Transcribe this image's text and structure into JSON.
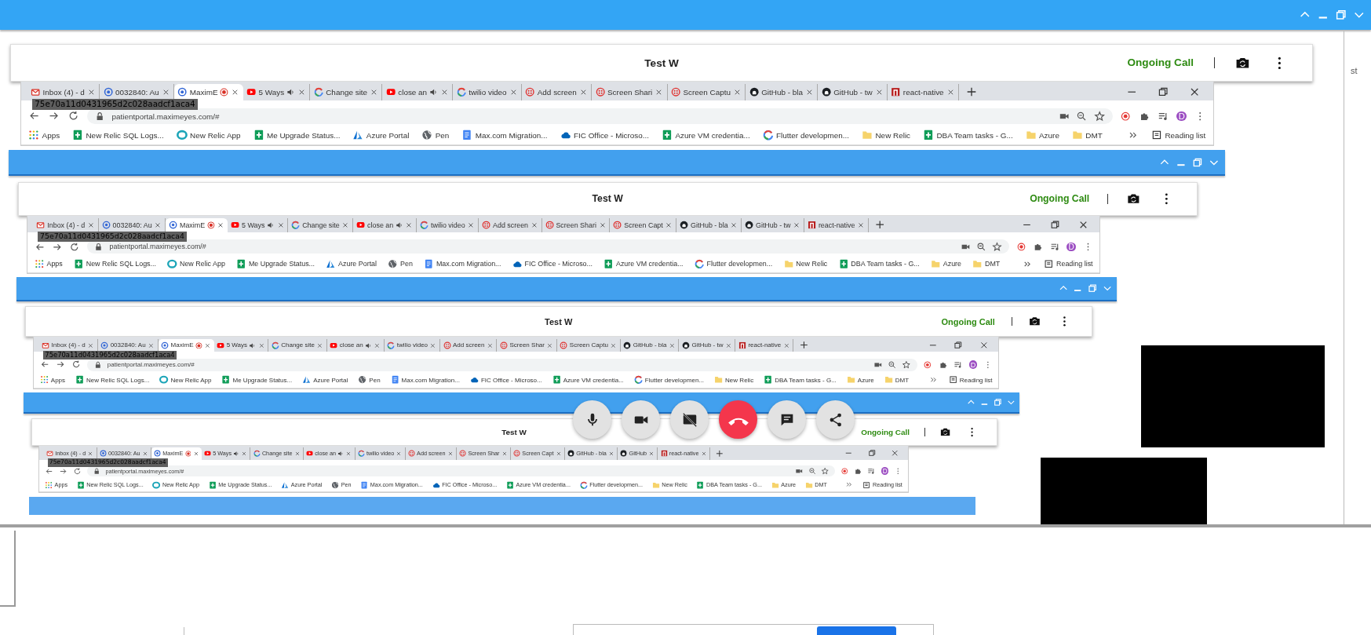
{
  "levels": [
    {
      "title": "Test W",
      "status": "Ongoing Call",
      "tooltip": "75e70a11d0431965d2c028aadcf1aca4",
      "url": "patientportal.maximeyes.com/#",
      "avatar": "D",
      "reading_list": "Reading list",
      "tabs": [
        {
          "label": "Inbox (4) - d",
          "kind": "mail",
          "selected": false,
          "audio": false,
          "recording": false
        },
        {
          "label": "0032840: Au",
          "kind": "swirl",
          "selected": false,
          "audio": false,
          "recording": false
        },
        {
          "label": "MaximE",
          "kind": "swirl",
          "selected": true,
          "audio": false,
          "recording": true
        },
        {
          "label": "5 Ways",
          "kind": "video",
          "selected": false,
          "audio": true,
          "recording": false
        },
        {
          "label": "Change site",
          "kind": "search",
          "selected": false,
          "audio": false,
          "recording": false
        },
        {
          "label": "close an",
          "kind": "video",
          "selected": false,
          "audio": true,
          "recording": false
        },
        {
          "label": "twilio video",
          "kind": "search",
          "selected": false,
          "audio": false,
          "recording": false
        },
        {
          "label": "Add screen",
          "kind": "dots",
          "selected": false,
          "audio": false,
          "recording": false
        },
        {
          "label": "Screen Shari",
          "kind": "dots",
          "selected": false,
          "audio": false,
          "recording": false
        },
        {
          "label": "Screen Captu",
          "kind": "dots",
          "selected": false,
          "audio": false,
          "recording": false
        },
        {
          "label": "GitHub - bla",
          "kind": "octo",
          "selected": false,
          "audio": false,
          "recording": false
        },
        {
          "label": "GitHub - tw",
          "kind": "octo",
          "selected": false,
          "audio": false,
          "recording": false
        },
        {
          "label": "react-native",
          "kind": "square",
          "selected": false,
          "audio": false,
          "recording": false
        }
      ],
      "bookmarks": [
        {
          "label": "Apps",
          "kind": "apps"
        },
        {
          "label": "New Relic SQL Logs...",
          "kind": "sheet"
        },
        {
          "label": "New Relic App",
          "kind": "relic"
        },
        {
          "label": "Me Upgrade Status...",
          "kind": "sheet"
        },
        {
          "label": "Azure Portal",
          "kind": "azure"
        },
        {
          "label": "Pen",
          "kind": "globe"
        },
        {
          "label": "Max.com Migration...",
          "kind": "doc"
        },
        {
          "label": "FIC Office - Microso...",
          "kind": "cloud"
        },
        {
          "label": "Azure VM credentia...",
          "kind": "sheet"
        },
        {
          "label": "Flutter developmen...",
          "kind": "search"
        },
        {
          "label": "New Relic",
          "kind": "folder"
        },
        {
          "label": "DBA Team tasks - G...",
          "kind": "sheet"
        },
        {
          "label": "Azure",
          "kind": "folder"
        },
        {
          "label": "DMT",
          "kind": "folder"
        }
      ]
    },
    {
      "title": "Test W",
      "status": "Ongoing Call",
      "tooltip": "75e70a11d0431965d2c028aadcf1aca4",
      "url": "patientportal.maximeyes.com/#",
      "avatar": "D",
      "reading_list": "Reading list",
      "tabs": [
        {
          "label": "Inbox (4) - d",
          "kind": "mail",
          "selected": false,
          "audio": false,
          "recording": false
        },
        {
          "label": "0032840: Au",
          "kind": "swirl",
          "selected": false,
          "audio": false,
          "recording": false
        },
        {
          "label": "MaximE",
          "kind": "swirl",
          "selected": true,
          "audio": false,
          "recording": true
        },
        {
          "label": "5 Ways",
          "kind": "video",
          "selected": false,
          "audio": true,
          "recording": false
        },
        {
          "label": "Change site",
          "kind": "search",
          "selected": false,
          "audio": false,
          "recording": false
        },
        {
          "label": "close an",
          "kind": "video",
          "selected": false,
          "audio": true,
          "recording": false
        },
        {
          "label": "twilio video",
          "kind": "search",
          "selected": false,
          "audio": false,
          "recording": false
        },
        {
          "label": "Add screen",
          "kind": "dots",
          "selected": false,
          "audio": false,
          "recording": false
        },
        {
          "label": "Screen Shari",
          "kind": "dots",
          "selected": false,
          "audio": false,
          "recording": false
        },
        {
          "label": "Screen Capt",
          "kind": "dots",
          "selected": false,
          "audio": false,
          "recording": false
        },
        {
          "label": "GitHub - bla",
          "kind": "octo",
          "selected": false,
          "audio": false,
          "recording": false
        },
        {
          "label": "GitHub - tw",
          "kind": "octo",
          "selected": false,
          "audio": false,
          "recording": false
        },
        {
          "label": "react-native",
          "kind": "square",
          "selected": false,
          "audio": false,
          "recording": false
        }
      ],
      "bookmarks": [
        {
          "label": "Apps",
          "kind": "apps"
        },
        {
          "label": "New Relic SQL Logs...",
          "kind": "sheet"
        },
        {
          "label": "New Relic App",
          "kind": "relic"
        },
        {
          "label": "Me Upgrade Status...",
          "kind": "sheet"
        },
        {
          "label": "Azure Portal",
          "kind": "azure"
        },
        {
          "label": "Pen",
          "kind": "globe"
        },
        {
          "label": "Max.com Migration...",
          "kind": "doc"
        },
        {
          "label": "FIC Office - Microso...",
          "kind": "cloud"
        },
        {
          "label": "Azure VM credentia...",
          "kind": "sheet"
        },
        {
          "label": "Flutter developmen...",
          "kind": "search"
        },
        {
          "label": "New Relic",
          "kind": "folder"
        },
        {
          "label": "DBA Team tasks - G...",
          "kind": "sheet"
        },
        {
          "label": "Azure",
          "kind": "folder"
        },
        {
          "label": "DMT",
          "kind": "folder"
        }
      ]
    },
    {
      "title": "Test W",
      "status": "Ongoing Call",
      "tooltip": "75e70a11d0431965d2c028aadcf1aca4",
      "url": "patientportal.maximeyes.com/#",
      "avatar": "D",
      "reading_list": "Reading list",
      "tabs": [
        {
          "label": "Inbox (4) - d",
          "kind": "mail",
          "selected": false,
          "audio": false,
          "recording": false
        },
        {
          "label": "0032840: Au",
          "kind": "swirl",
          "selected": false,
          "audio": false,
          "recording": false
        },
        {
          "label": "MaximE",
          "kind": "swirl",
          "selected": true,
          "audio": false,
          "recording": true
        },
        {
          "label": "5 Ways",
          "kind": "video",
          "selected": false,
          "audio": true,
          "recording": false
        },
        {
          "label": "Change site",
          "kind": "search",
          "selected": false,
          "audio": false,
          "recording": false
        },
        {
          "label": "close an",
          "kind": "video",
          "selected": false,
          "audio": true,
          "recording": false
        },
        {
          "label": "twilio video",
          "kind": "search",
          "selected": false,
          "audio": false,
          "recording": false
        },
        {
          "label": "Add screen",
          "kind": "dots",
          "selected": false,
          "audio": false,
          "recording": false
        },
        {
          "label": "Screen Shar",
          "kind": "dots",
          "selected": false,
          "audio": false,
          "recording": false
        },
        {
          "label": "Screen Captu",
          "kind": "dots",
          "selected": false,
          "audio": false,
          "recording": false
        },
        {
          "label": "GitHub - bla",
          "kind": "octo",
          "selected": false,
          "audio": false,
          "recording": false
        },
        {
          "label": "GitHub - tw",
          "kind": "octo",
          "selected": false,
          "audio": false,
          "recording": false
        },
        {
          "label": "react-native",
          "kind": "square",
          "selected": false,
          "audio": false,
          "recording": false
        }
      ],
      "bookmarks": [
        {
          "label": "Apps",
          "kind": "apps"
        },
        {
          "label": "New Relic SQL Logs...",
          "kind": "sheet"
        },
        {
          "label": "New Relic App",
          "kind": "relic"
        },
        {
          "label": "Me Upgrade Status...",
          "kind": "sheet"
        },
        {
          "label": "Azure Portal",
          "kind": "azure"
        },
        {
          "label": "Pen",
          "kind": "globe"
        },
        {
          "label": "Max.com Migration...",
          "kind": "doc"
        },
        {
          "label": "FIC Office - Microso...",
          "kind": "cloud"
        },
        {
          "label": "Azure VM credentia...",
          "kind": "sheet"
        },
        {
          "label": "Flutter developmen...",
          "kind": "search"
        },
        {
          "label": "New Relic",
          "kind": "folder"
        },
        {
          "label": "DBA Team tasks - G...",
          "kind": "sheet"
        },
        {
          "label": "Azure",
          "kind": "folder"
        },
        {
          "label": "DMT",
          "kind": "folder"
        }
      ]
    },
    {
      "title": "Test W",
      "status": "Ongoing Call",
      "tooltip": "75e70a11d0431965d2c028aadcf1aca4",
      "url": "patientportal.maximeyes.com/#",
      "avatar": "D",
      "reading_list": "Reading list",
      "tabs": [
        {
          "label": "Inbox (4) - d",
          "kind": "mail",
          "selected": false,
          "audio": false,
          "recording": false
        },
        {
          "label": "0032840: Au",
          "kind": "swirl",
          "selected": false,
          "audio": false,
          "recording": false
        },
        {
          "label": "MaximE",
          "kind": "swirl",
          "selected": true,
          "audio": false,
          "recording": true
        },
        {
          "label": "5 Ways",
          "kind": "video",
          "selected": false,
          "audio": true,
          "recording": false
        },
        {
          "label": "Change site",
          "kind": "search",
          "selected": false,
          "audio": false,
          "recording": false
        },
        {
          "label": "close an",
          "kind": "video",
          "selected": false,
          "audio": true,
          "recording": false
        },
        {
          "label": "twilio video",
          "kind": "search",
          "selected": false,
          "audio": false,
          "recording": false
        },
        {
          "label": "Add screen",
          "kind": "dots",
          "selected": false,
          "audio": false,
          "recording": false
        },
        {
          "label": "Screen Shar",
          "kind": "dots",
          "selected": false,
          "audio": false,
          "recording": false
        },
        {
          "label": "Screen Capt",
          "kind": "dots",
          "selected": false,
          "audio": false,
          "recording": false
        },
        {
          "label": "GitHub - bla",
          "kind": "octo",
          "selected": false,
          "audio": false,
          "recording": false
        },
        {
          "label": "GitHub",
          "kind": "octo",
          "selected": false,
          "audio": false,
          "recording": false
        },
        {
          "label": "react-native",
          "kind": "square",
          "selected": false,
          "audio": false,
          "recording": false
        }
      ],
      "bookmarks": [
        {
          "label": "Apps",
          "kind": "apps"
        },
        {
          "label": "New Relic SQL Logs...",
          "kind": "sheet"
        },
        {
          "label": "New Relic App",
          "kind": "relic"
        },
        {
          "label": "Me Upgrade Status...",
          "kind": "sheet"
        },
        {
          "label": "Azure Portal",
          "kind": "azure"
        },
        {
          "label": "Pen",
          "kind": "globe"
        },
        {
          "label": "Max.com Migration...",
          "kind": "doc"
        },
        {
          "label": "FIC Office - Microso...",
          "kind": "cloud"
        },
        {
          "label": "Azure VM credentia...",
          "kind": "sheet"
        },
        {
          "label": "Flutter developmen...",
          "kind": "search"
        },
        {
          "label": "New Relic",
          "kind": "folder"
        },
        {
          "label": "DBA Team tasks - G...",
          "kind": "sheet"
        },
        {
          "label": "Azure",
          "kind": "folder"
        },
        {
          "label": "DMT",
          "kind": "folder"
        }
      ]
    }
  ],
  "side_text": "st",
  "call_controls": [
    {
      "kind": "mic"
    },
    {
      "kind": "camera"
    },
    {
      "kind": "screen-off"
    },
    {
      "kind": "end-call"
    },
    {
      "kind": "chat"
    },
    {
      "kind": "share"
    }
  ]
}
